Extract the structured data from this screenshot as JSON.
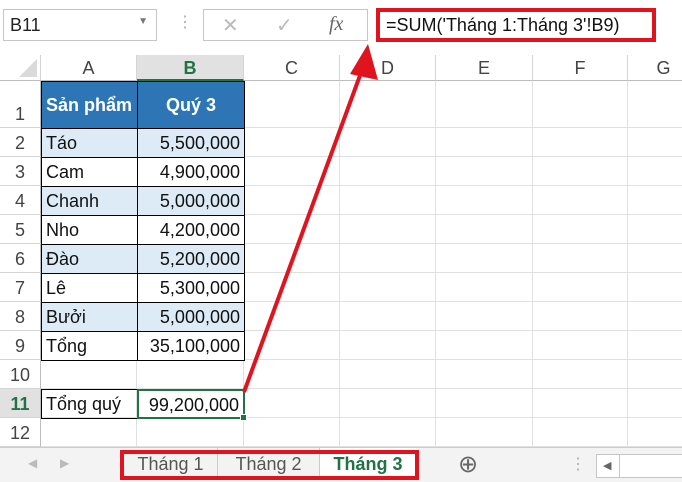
{
  "formula_bar": {
    "name_box": "B11",
    "cancel_icon": "✕",
    "enter_icon": "✓",
    "fx_label": "fx",
    "formula": "=SUM('Tháng 1:Tháng 3'!B9)"
  },
  "columns": [
    "A",
    "B",
    "C",
    "D",
    "E",
    "F",
    "G"
  ],
  "rows": [
    "1",
    "2",
    "3",
    "4",
    "5",
    "6",
    "7",
    "8",
    "9",
    "10",
    "11",
    "12"
  ],
  "table": {
    "headers": [
      "Sản phẩm",
      "Quý 3"
    ],
    "rows": [
      [
        "Táo",
        "5,500,000"
      ],
      [
        "Cam",
        "4,900,000"
      ],
      [
        "Chanh",
        "5,000,000"
      ],
      [
        "Nho",
        "4,200,000"
      ],
      [
        "Đào",
        "5,200,000"
      ],
      [
        "Lê",
        "5,300,000"
      ],
      [
        "Bưởi",
        "5,000,000"
      ],
      [
        "Tổng",
        "35,100,000"
      ]
    ]
  },
  "total": {
    "label": "Tổng quý",
    "value": "99,200,000"
  },
  "sheets": {
    "tabs": [
      "Tháng 1",
      "Tháng 2",
      "Tháng 3"
    ],
    "active": "Tháng 3",
    "add_icon": "⊕"
  },
  "colors": {
    "header_blue": "#2E75B6",
    "band": "#DDEBF7",
    "excel_green": "#217346",
    "annotation_red": "#E0141E"
  }
}
